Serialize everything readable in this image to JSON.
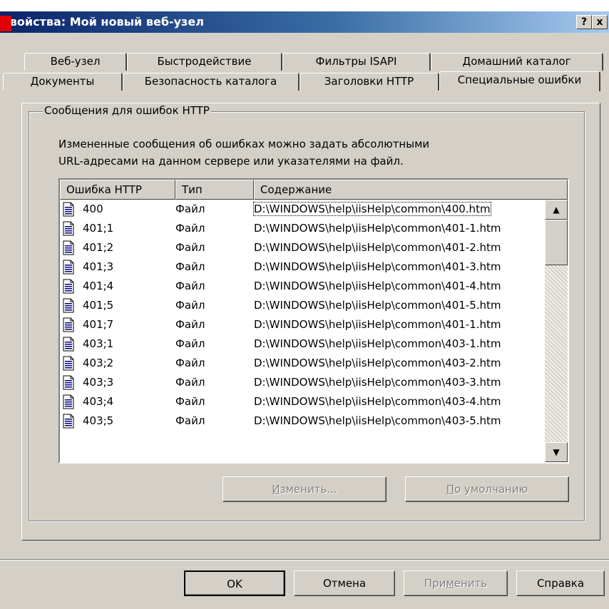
{
  "window": {
    "title": "Свойства: Мой новый веб-узел",
    "help_button": "?",
    "close_button": "x",
    "titlebar_color": "#0a246a"
  },
  "tabs_back": [
    "Веб-узел",
    "Быстродействие",
    "Фильтры ISAPI",
    "Домашний каталог"
  ],
  "tabs_front": [
    "Документы",
    "Безопасность каталога",
    "Заголовки HTTP",
    "Специальные ошибки"
  ],
  "active_tab": "Специальные ошибки",
  "group": {
    "label": "Сообщения для ошибок HTTP",
    "description_line1": "Измененные сообщения об ошибках можно задать абсолютными",
    "description_line2": "URL-адресами на данном сервере или указателями на файл."
  },
  "list": {
    "columns": [
      "Ошибка HTTP",
      "Тип",
      "Содержание"
    ],
    "rows": [
      {
        "code": "400",
        "type": "Файл",
        "content": "D:\\WINDOWS\\help\\iisHelp\\common\\400.htm"
      },
      {
        "code": "401;1",
        "type": "Файл",
        "content": "D:\\WINDOWS\\help\\iisHelp\\common\\401-1.htm"
      },
      {
        "code": "401;2",
        "type": "Файл",
        "content": "D:\\WINDOWS\\help\\iisHelp\\common\\401-2.htm"
      },
      {
        "code": "401;3",
        "type": "Файл",
        "content": "D:\\WINDOWS\\help\\iisHelp\\common\\401-3.htm"
      },
      {
        "code": "401;4",
        "type": "Файл",
        "content": "D:\\WINDOWS\\help\\iisHelp\\common\\401-4.htm"
      },
      {
        "code": "401;5",
        "type": "Файл",
        "content": "D:\\WINDOWS\\help\\iisHelp\\common\\401-5.htm"
      },
      {
        "code": "401;7",
        "type": "Файл",
        "content": "D:\\WINDOWS\\help\\iisHelp\\common\\401-1.htm"
      },
      {
        "code": "403;1",
        "type": "Файл",
        "content": "D:\\WINDOWS\\help\\iisHelp\\common\\403-1.htm"
      },
      {
        "code": "403;2",
        "type": "Файл",
        "content": "D:\\WINDOWS\\help\\iisHelp\\common\\403-2.htm"
      },
      {
        "code": "403;3",
        "type": "Файл",
        "content": "D:\\WINDOWS\\help\\iisHelp\\common\\403-3.htm"
      },
      {
        "code": "403;4",
        "type": "Файл",
        "content": "D:\\WINDOWS\\help\\iisHelp\\common\\403-4.htm"
      },
      {
        "code": "403;5",
        "type": "Файл",
        "content": "D:\\WINDOWS\\help\\iisHelp\\common\\403-5.htm"
      }
    ],
    "scroll_up_glyph": "▲",
    "scroll_down_glyph": "▼"
  },
  "buttons": {
    "edit_prefix": "",
    "edit_underline": "И",
    "edit_rest": "зменить...",
    "default_underline": "П",
    "default_rest": "о умолчанию",
    "ok": "OK",
    "cancel": "Отмена",
    "apply_prefix": "При",
    "apply_underline": "м",
    "apply_rest": "енить",
    "help": "Справка"
  }
}
